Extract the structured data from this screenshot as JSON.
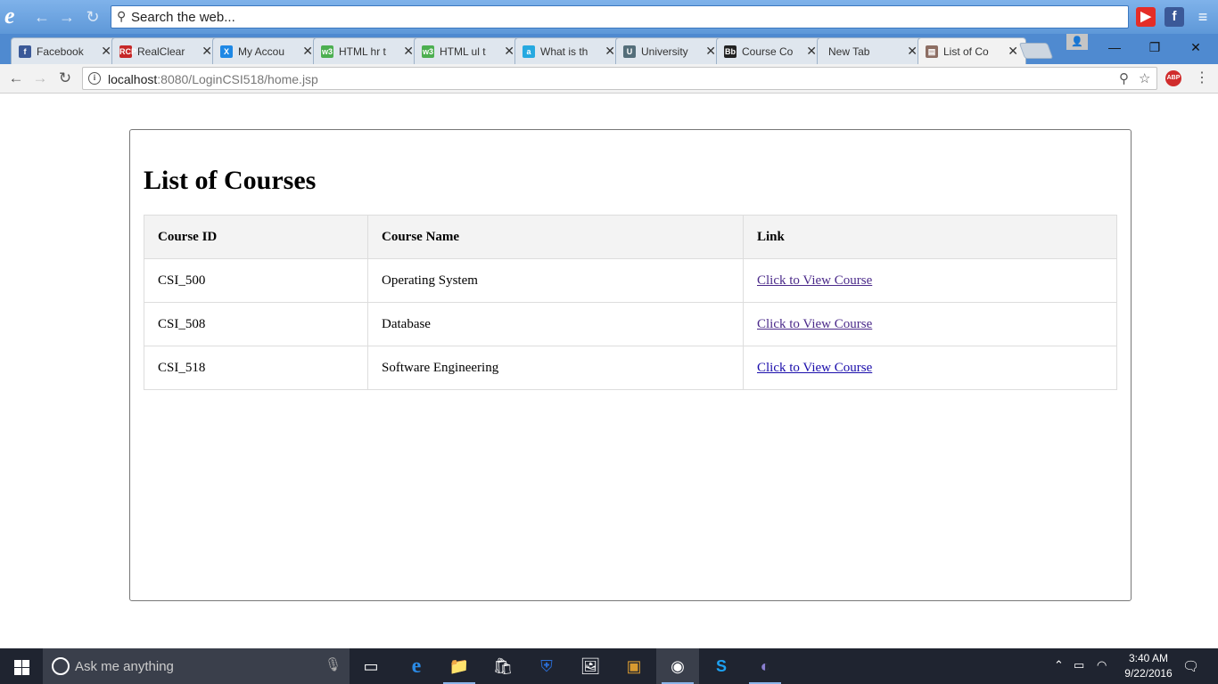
{
  "ie_bar": {
    "search_placeholder": "Search the web..."
  },
  "tabs": [
    {
      "label": "Facebook",
      "favicon": "facebook-icon",
      "color": "#3b5998",
      "glyph": "f"
    },
    {
      "label": "RealClear",
      "favicon": "rcp-icon",
      "color": "#c62828",
      "glyph": "RCP"
    },
    {
      "label": "My Accou",
      "favicon": "x-logo-icon",
      "color": "#1e88e5",
      "glyph": "X"
    },
    {
      "label": "HTML hr t",
      "favicon": "w3-icon",
      "color": "#4caf50",
      "glyph": "w3"
    },
    {
      "label": "HTML ul t",
      "favicon": "w3-icon",
      "color": "#4caf50",
      "glyph": "w3"
    },
    {
      "label": "What is th",
      "favicon": "answers-icon",
      "color": "#26a9e0",
      "glyph": "a"
    },
    {
      "label": "University",
      "favicon": "university-icon",
      "color": "#546e7a",
      "glyph": "U"
    },
    {
      "label": "Course Co",
      "favicon": "blackboard-icon",
      "color": "#222222",
      "glyph": "Bb"
    },
    {
      "label": "New Tab",
      "favicon": "",
      "color": "",
      "glyph": ""
    },
    {
      "label": "List of Co",
      "favicon": "page-icon",
      "color": "#8d6e63",
      "glyph": "▤",
      "active": true
    }
  ],
  "address": {
    "host": "localhost",
    "path": ":8080/LoginCSI518/home.jsp"
  },
  "page": {
    "heading": "List of Courses",
    "table": {
      "headers": [
        "Course ID",
        "Course Name",
        "Link"
      ],
      "rows": [
        {
          "id": "CSI_500",
          "name": "Operating System",
          "link": "Click to View Course"
        },
        {
          "id": "CSI_508",
          "name": "Database",
          "link": "Click to View Course"
        },
        {
          "id": "CSI_518",
          "name": "Software Engineering",
          "link": "Click to View Course"
        }
      ]
    }
  },
  "taskbar": {
    "search_placeholder": "Ask me anything",
    "time": "3:40 AM",
    "date": "9/22/2016"
  },
  "colors": {
    "visited_link": "#4b2a8a",
    "link": "#1a0dab",
    "taskbar": "#1f2430"
  }
}
